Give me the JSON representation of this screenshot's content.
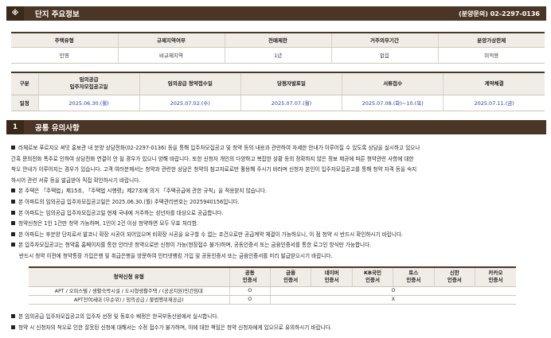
{
  "section_main": {
    "icon": "※",
    "title": "단지 주요정보",
    "contact_label": "(분양문의)",
    "contact_phone": "02-2297-0136"
  },
  "info_table": {
    "headers": [
      "주택유형",
      "규제지역여부",
      "전매제한",
      "거주의무기간",
      "분양가상한제"
    ],
    "values": [
      "민영",
      "비규제지역",
      "1년",
      "없음",
      "미적용"
    ]
  },
  "schedule_table": {
    "headers": [
      "구분",
      "임의공급\n입주자모집공고일",
      "임의공급 청약접수일",
      "당첨자발표일",
      "서류접수",
      "계약체결"
    ],
    "row_label": "일정",
    "values": [
      "2025.06.30.(월)",
      "2025.07.02.(수)",
      "2025.07.07.(월)",
      "2025.07.08.(화)~10.(목)",
      "2025.07.11.(금)"
    ]
  },
  "section_notice": {
    "number": "1",
    "title": "공통 유의사항"
  },
  "notice_lines": [
    "라체르보 푸르지오 써밋 홍보관 내 분양 상담전화(02-2297-0136) 등을 통해 입주자모집공고 및 청약 등의 내용과 관련하여 자세한 안내가 이루어질 수 있도록 상담을 실시하고 있으나",
    "간혹 문의전화 폭주로 인하여 상담전화 연결이 안 될 경우가 있으니 양해 바랍니다. 또한 신청자 개인의 다양하고 복잡한 상황 등의 정확하지 않은 정보 제공에 따른 청약관련 사항에 대한",
    "착오 안내가 이루어지는 경우가 있습니다. 고객 여러분께서는 청약과 관련한 상담은 청약의 참고자료로만 활용해 주시기 바라며 신청자 본인이 입주자모집공고를 통해 청약 자격 등을 숙지",
    "하시어 관련 서류 등을 발급받아 직접 확인하시기 바랍니다.",
    "본 주택은 「주택법」제15조, 「주택법 시행령」제27조에 의거 「주택공급에 관한 규칙」을 적용받지 않습니다.",
    "본 아파트의 임의공급 입주자모집공고일은 2025.06.30.(월) 주택관리번호는 2025940156입니다.",
    "본 아파트는 임의공급 입주자모집공고일 현재 국내에 거주하는 성년자를 대상으로 공급합니다.",
    "청약신청은 1인 1건만 청약 가능하며, 1인이 2건 이상 청약하면 모두 무효 처리함.",
    "본 아파트는 후분양 단지로서 발코니 확장 시공이 되어있으며 비확장 시공을 요구할 수 없는 조건으로만 공급계약 체결이 가능하오니, 이 점 청약 시 반드시 확인하시기 바랍니다.",
    "본 입주자모집공고는 청약홈 홈페이지를 통한 인터넷 청약으로만 신청이 가능(현장접수 불가)하며, 공동인증서 또는 금융인증서를 통한 로그인 방식만 가능합니다.",
    "반드시 청약 이전에 청약통장 가입은행 및 취급은행을 방문하여 인터넷뱅킹 가입 및 공동인증서 또는 금융인증서를 미리 발급받으시기 바랍니다."
  ],
  "cert_table": {
    "headers": [
      "청약신청 유형",
      "공동\n인증서",
      "금융\n인증서",
      "네이버\n인증서",
      "KB국민\n인증서",
      "토스\n인증서",
      "신한\n인증서",
      "카카오\n인증서"
    ],
    "rows": [
      {
        "type": "APT / 오피스텔 / 생활숙박시설 / 도시형생활주택 / (공공지원)민간임대",
        "common_mark": "O",
        "private_mark": "O"
      },
      {
        "type": "APT잔여세대 (무순위) / 임의공급 / 불법행위재공급)",
        "common_mark": "O",
        "private_mark": "X"
      }
    ]
  },
  "footer_lines": [
    "본 임의공급 입주자모집공고의 입주자 선정 및 동호수 배정은 한국부동산원에서 실시합니다.",
    "청약 시 신청자의 착오로 인한 잘못된 신청에 대해서는 수정 접수가 불가하며, 이에 대한 책임은 청약 신청자에게 있으므로 유의하시기 바랍니다."
  ]
}
